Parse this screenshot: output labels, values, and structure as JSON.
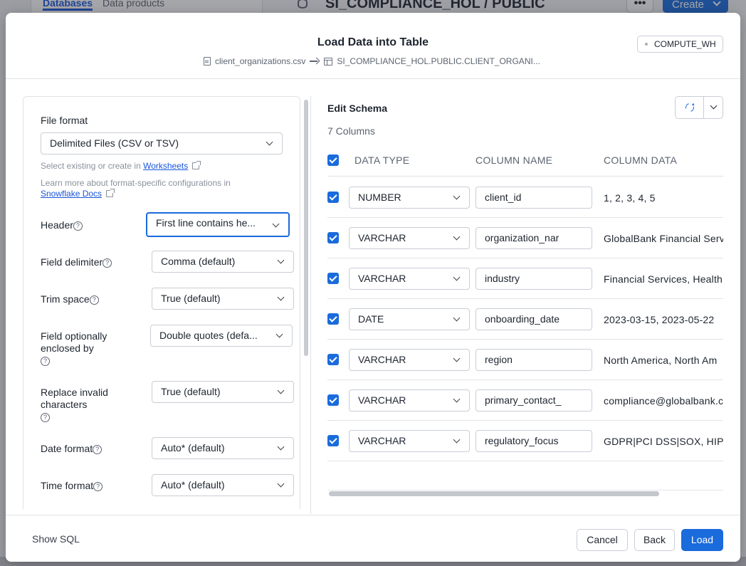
{
  "background": {
    "tabs": [
      "Databases",
      "Data products"
    ],
    "title": "SI_COMPLIANCE_HOL / PUBLIC",
    "more_label": "•••",
    "create_label": "Create"
  },
  "modal": {
    "title": "Load Data into Table",
    "source_file": "client_organizations.csv",
    "target_table": "SI_COMPLIANCE_HOL.PUBLIC.CLIENT_ORGANI...",
    "warehouse": "COMPUTE_WH"
  },
  "file_format": {
    "label": "File format",
    "value": "Delimited Files (CSV or TSV)",
    "hint1_prefix": "Select existing or create in ",
    "hint1_link": "Worksheets",
    "hint2_prefix": "Learn more about format-specific configurations in",
    "hint2_link": "Snowflake Docs"
  },
  "options": [
    {
      "label": "Header",
      "value": "First line contains he..."
    },
    {
      "label": "Field delimiter",
      "value": "Comma (default)"
    },
    {
      "label": "Trim space",
      "value": "True (default)"
    },
    {
      "label": "Field optionally enclosed by",
      "value": "Double quotes (defa..."
    },
    {
      "label": "Replace invalid characters",
      "value": "True (default)"
    },
    {
      "label": "Date format",
      "value": "Auto* (default)"
    },
    {
      "label": "Time format",
      "value": "Auto* (default)"
    }
  ],
  "schema": {
    "title": "Edit Schema",
    "count": "7 Columns",
    "headers": {
      "type": "DATA TYPE",
      "name": "COLUMN NAME",
      "data": "COLUMN DATA"
    },
    "rows": [
      {
        "type": "NUMBER",
        "name": "client_id",
        "data": "1, 2, 3, 4, 5"
      },
      {
        "type": "VARCHAR",
        "name": "organization_nar",
        "data": "GlobalBank Financial Serv"
      },
      {
        "type": "VARCHAR",
        "name": "industry",
        "data": "Financial Services, Health"
      },
      {
        "type": "DATE",
        "name": "onboarding_date",
        "data": "2023-03-15, 2023-05-22"
      },
      {
        "type": "VARCHAR",
        "name": "region",
        "data": "North America, North Am"
      },
      {
        "type": "VARCHAR",
        "name": "primary_contact_",
        "data": "compliance@globalbank.c"
      },
      {
        "type": "VARCHAR",
        "name": "regulatory_focus",
        "data": "GDPR|PCI DSS|SOX, HIPA"
      }
    ]
  },
  "footer": {
    "show_sql": "Show SQL",
    "cancel": "Cancel",
    "back": "Back",
    "load": "Load"
  },
  "colors": {
    "accent": "#1a6bdc",
    "border": "#c9cdd4"
  }
}
